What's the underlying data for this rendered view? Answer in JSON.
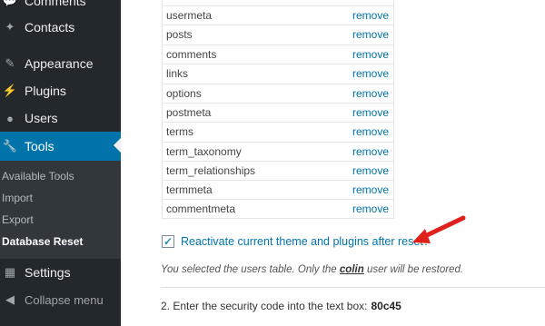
{
  "sidebar": {
    "items_top": [
      {
        "label": "Comments",
        "icon": "comments-icon"
      },
      {
        "label": "Contacts",
        "icon": "pin-icon"
      }
    ],
    "items": [
      {
        "label": "Appearance",
        "icon": "paintbrush-icon"
      },
      {
        "label": "Plugins",
        "icon": "plug-icon"
      },
      {
        "label": "Users",
        "icon": "user-icon"
      },
      {
        "label": "Tools",
        "icon": "wrench-icon"
      }
    ],
    "submenu": [
      "Available Tools",
      "Import",
      "Export",
      "Database Reset"
    ],
    "settings": {
      "label": "Settings",
      "icon": "settings-icon"
    },
    "collapse": {
      "label": "Collapse menu",
      "icon": "collapse-icon"
    }
  },
  "tables": [
    {
      "name": "usermeta",
      "action": "remove"
    },
    {
      "name": "posts",
      "action": "remove"
    },
    {
      "name": "comments",
      "action": "remove"
    },
    {
      "name": "links",
      "action": "remove"
    },
    {
      "name": "options",
      "action": "remove"
    },
    {
      "name": "postmeta",
      "action": "remove"
    },
    {
      "name": "terms",
      "action": "remove"
    },
    {
      "name": "term_taxonomy",
      "action": "remove"
    },
    {
      "name": "term_relationships",
      "action": "remove"
    },
    {
      "name": "termmeta",
      "action": "remove"
    },
    {
      "name": "commentmeta",
      "action": "remove"
    }
  ],
  "reactivate": {
    "label": "Reactivate current theme and plugins after reset?",
    "checked": true
  },
  "note": {
    "before": "You selected the users table. Only the ",
    "user": "colin",
    "after": " user will be restored."
  },
  "step": {
    "text": "2. Enter the security code into the text box:",
    "code": "80c45"
  },
  "colors": {
    "accent": "#0073aa",
    "sidebar": "#23282d",
    "arrow": "#e0211b"
  }
}
